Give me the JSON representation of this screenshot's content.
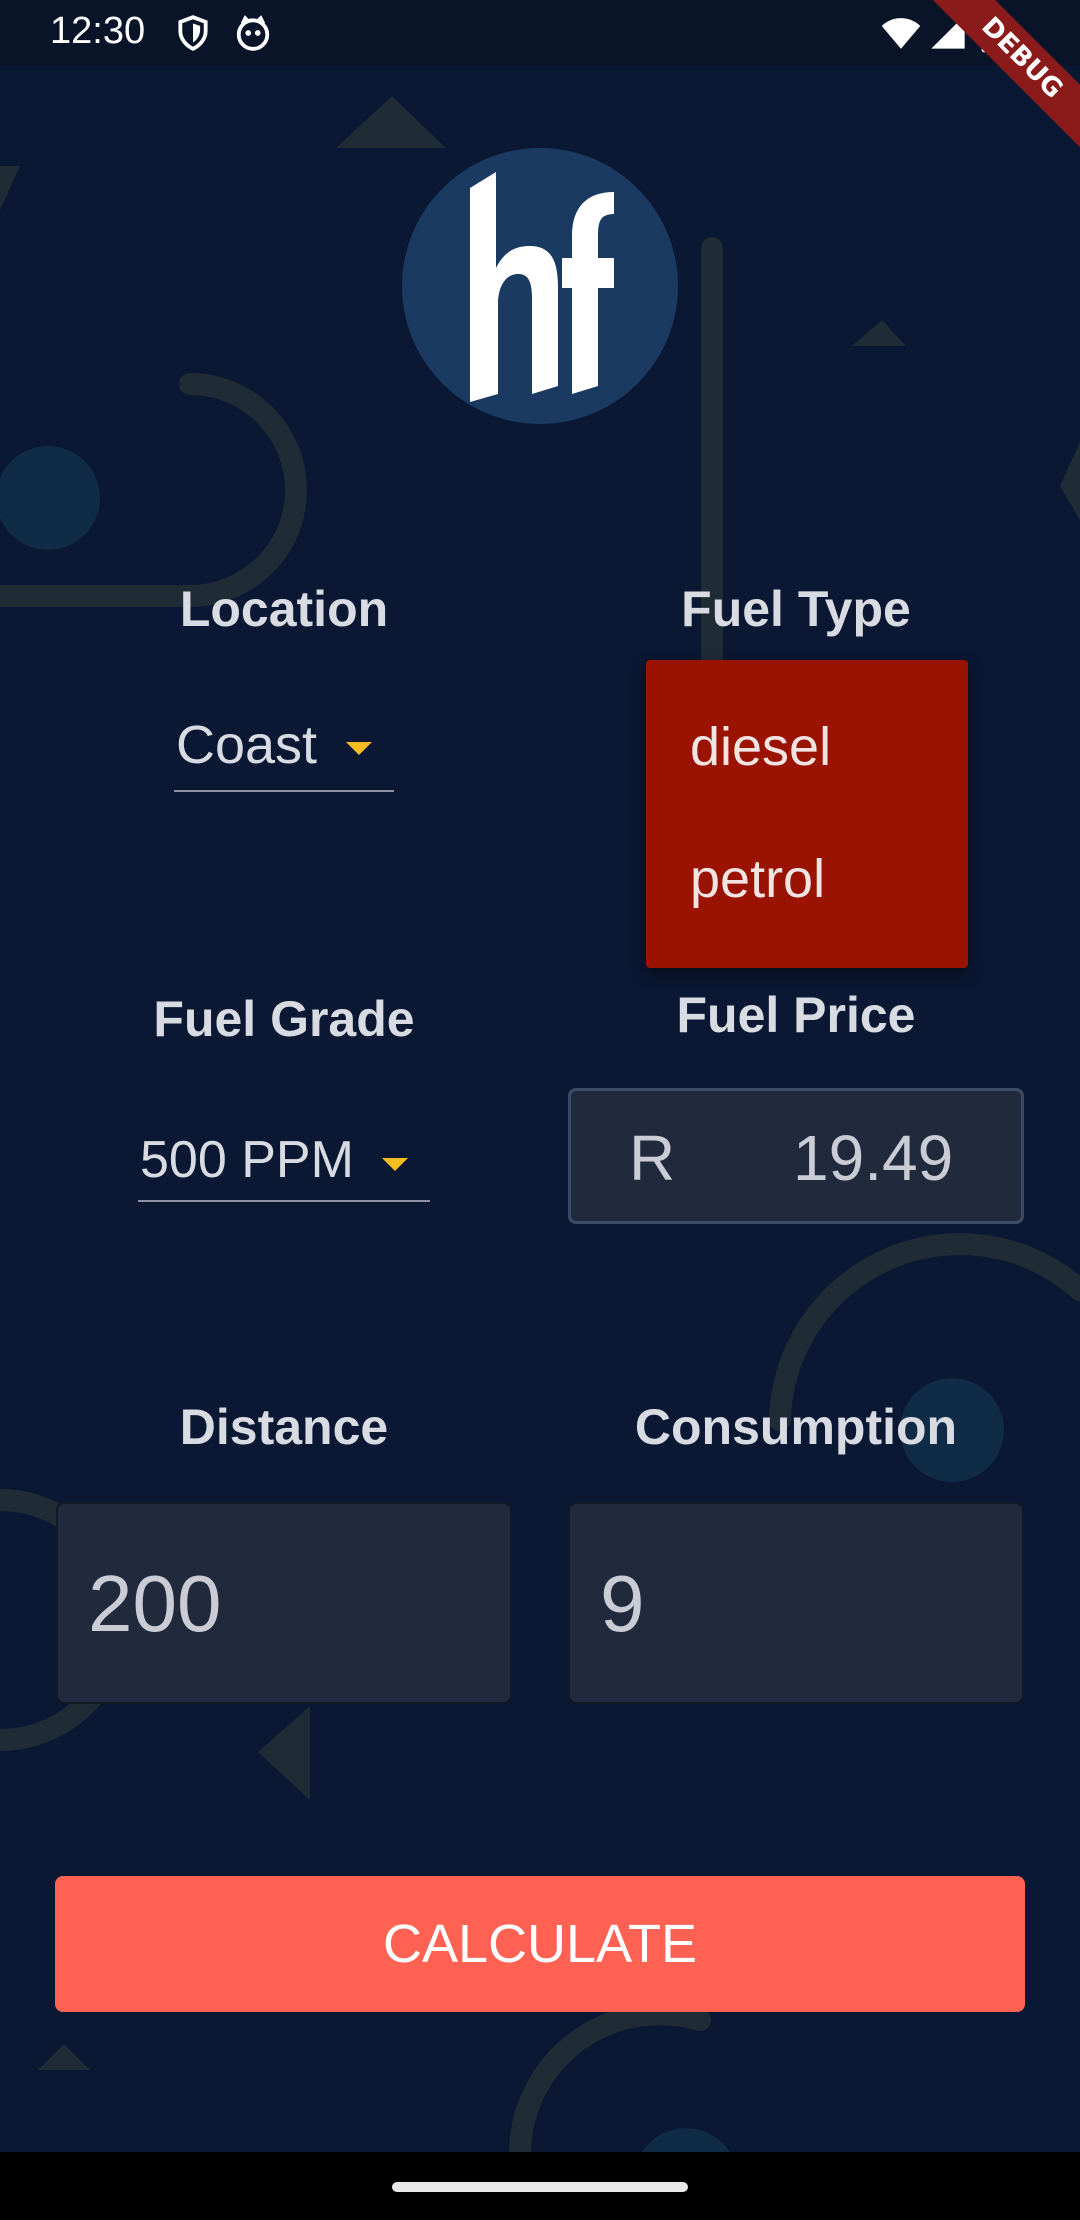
{
  "status_bar": {
    "time": "12:30",
    "debug_label": "DEBUG"
  },
  "logo": {
    "text": "hf"
  },
  "location": {
    "label": "Location",
    "value": "Coast"
  },
  "fuel_type": {
    "label": "Fuel Type",
    "options": [
      "diesel",
      "petrol"
    ]
  },
  "fuel_grade": {
    "label": "Fuel Grade",
    "value": "500 PPM"
  },
  "fuel_price": {
    "label": "Fuel Price",
    "currency": "R",
    "value": "19.49"
  },
  "distance": {
    "label": "Distance",
    "value": "200"
  },
  "consumption": {
    "label": "Consumption",
    "value": "9"
  },
  "calculate_button": {
    "label": "CALCULATE"
  },
  "colors": {
    "background": "#0b1833",
    "accent": "#ff6252",
    "menu": "#9a1200",
    "caret": "#f5bd1f",
    "field": "#212a3d"
  }
}
